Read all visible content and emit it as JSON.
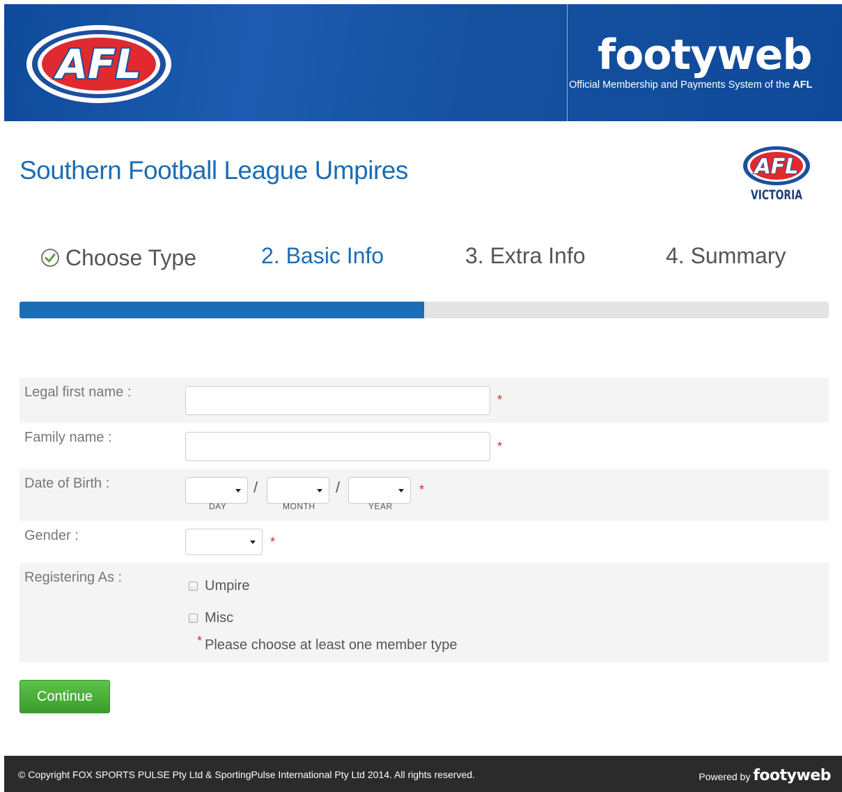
{
  "header": {
    "afl_logo_text": "AFL",
    "brand": "footyweb",
    "tagline_prefix": "Official Membership and Payments System of the ",
    "tagline_bold": "AFL"
  },
  "org": {
    "title": "Southern Football League Umpires",
    "logo_main": "AFL",
    "logo_sub": "VICTORIA"
  },
  "steps": [
    {
      "label": "Choose Type",
      "state": "complete",
      "icon": "check-circle-icon"
    },
    {
      "label": "2. Basic Info",
      "state": "active"
    },
    {
      "label": "3. Extra Info",
      "state": "pending"
    },
    {
      "label": "4. Summary",
      "state": "pending"
    }
  ],
  "progress": {
    "fraction": 0.5
  },
  "form": {
    "first_name_label": "Legal first name :",
    "first_name_value": "",
    "family_name_label": "Family name :",
    "family_name_value": "",
    "dob_label": "Date of Birth :",
    "dob_separator": "/",
    "dob_day_label": "DAY",
    "dob_month_label": "MONTH",
    "dob_year_label": "YEAR",
    "gender_label": "Gender :",
    "registering_label": "Registering As :",
    "options": [
      "Umpire",
      "Misc"
    ],
    "member_type_hint": "Please choose at least one member type",
    "required_marker": "*",
    "continue_label": "Continue"
  },
  "footer": {
    "copyright": "©  Copyright FOX SPORTS PULSE Pty Ltd & SportingPulse International Pty Ltd  2014.  All rights reserved.",
    "powered_by": "Powered by",
    "brand": "footyweb"
  },
  "colors": {
    "banner": "#0f4a9a",
    "accent": "#1b6db5",
    "required": "#e0252b",
    "button": "#4cb03a",
    "footer": "#2b2b2b"
  }
}
